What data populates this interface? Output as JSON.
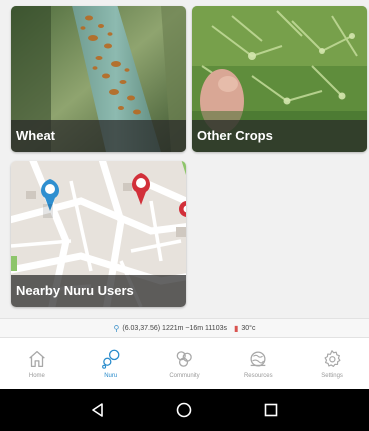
{
  "tiles": {
    "wheat": {
      "label": "Wheat"
    },
    "other_crops": {
      "label": "Other Crops"
    },
    "nearby_users": {
      "label": "Nearby Nuru Users"
    }
  },
  "status": {
    "location_text": "(6.03,37.56) 1221m ~16m 11103s",
    "temperature_text": "30°c"
  },
  "nav": {
    "active": "nuru",
    "items": [
      {
        "id": "home",
        "label": "Home",
        "icon": "home-icon"
      },
      {
        "id": "nuru",
        "label": "Nuru",
        "icon": "nuru-icon"
      },
      {
        "id": "community",
        "label": "Community",
        "icon": "community-icon"
      },
      {
        "id": "resources",
        "label": "Resources",
        "icon": "resources-icon"
      },
      {
        "id": "settings",
        "label": "Settings",
        "icon": "gear-icon"
      }
    ]
  },
  "colors": {
    "accent": "#2a8ccc",
    "inactive": "#9a9a9a",
    "pin_blue": "#2f8fd0",
    "pin_red": "#d2303a"
  },
  "system_bar": {
    "buttons": [
      "back-icon",
      "home-circle-icon",
      "recents-icon"
    ]
  }
}
